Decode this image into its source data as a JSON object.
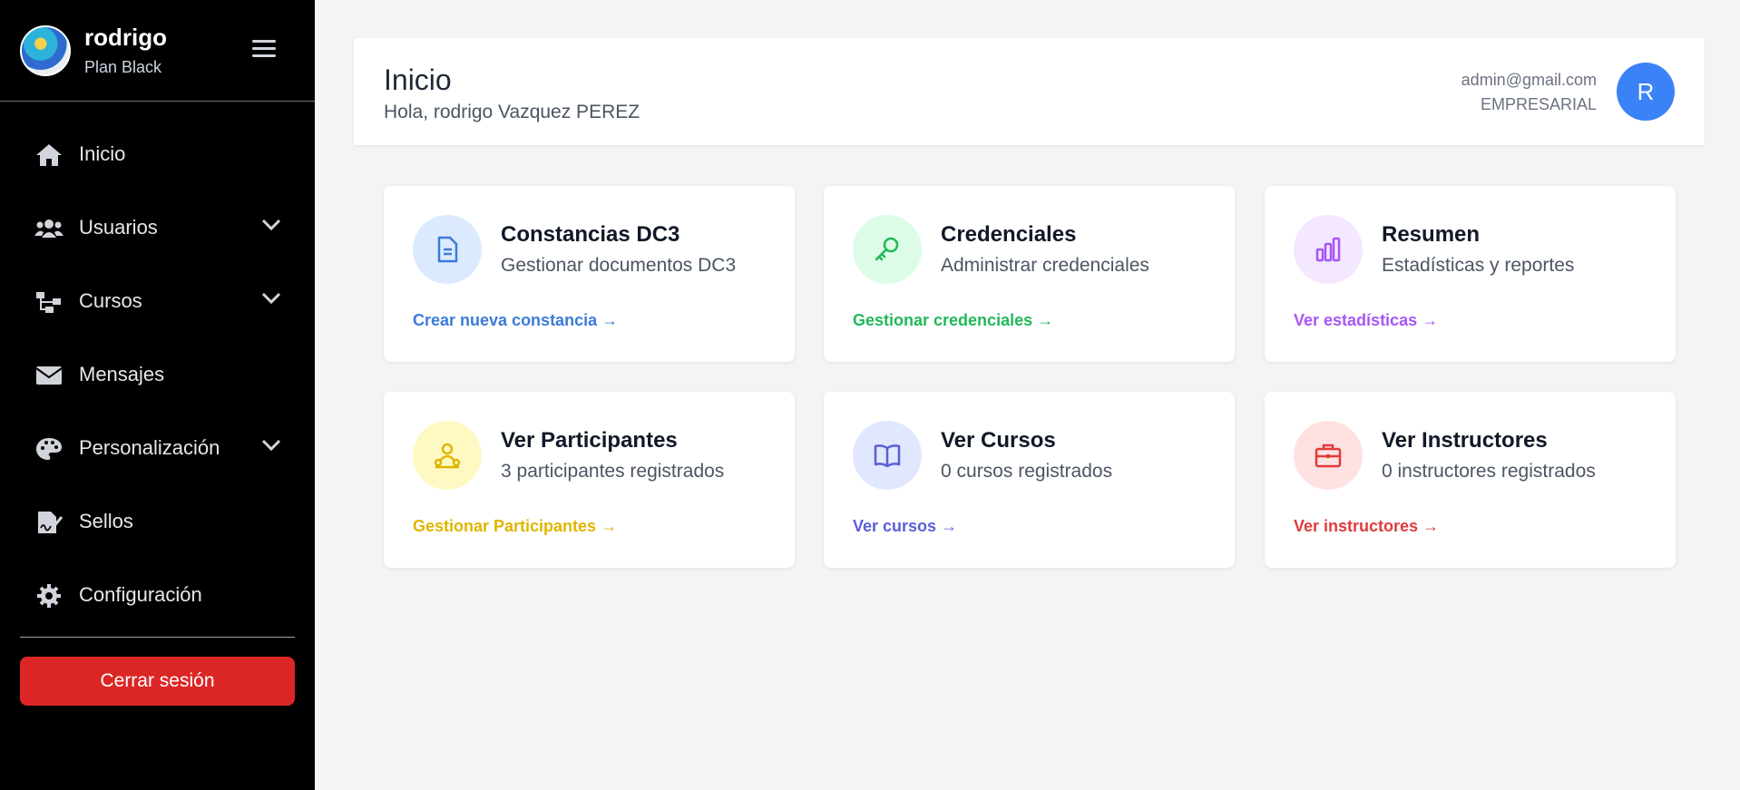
{
  "sidebar": {
    "user_name": "rodrigo",
    "user_plan": "Plan Black",
    "items": [
      {
        "label": "Inicio",
        "icon": "home-icon",
        "has_submenu": false
      },
      {
        "label": "Usuarios",
        "icon": "users-icon",
        "has_submenu": true
      },
      {
        "label": "Cursos",
        "icon": "sitemap-icon",
        "has_submenu": true
      },
      {
        "label": "Mensajes",
        "icon": "envelope-icon",
        "has_submenu": false
      },
      {
        "label": "Personalización",
        "icon": "palette-icon",
        "has_submenu": true
      },
      {
        "label": "Sellos",
        "icon": "signature-icon",
        "has_submenu": false
      },
      {
        "label": "Configuración",
        "icon": "gear-icon",
        "has_submenu": false
      }
    ],
    "logout_label": "Cerrar sesión"
  },
  "header": {
    "title": "Inicio",
    "greeting": "Hola, rodrigo Vazquez PEREZ",
    "email": "admin@gmail.com",
    "plan": "EMPRESARIAL",
    "avatar_letter": "R"
  },
  "cards": [
    {
      "title": "Constancias DC3",
      "subtitle": "Gestionar documentos DC3",
      "link": "Crear nueva constancia →",
      "icon": "document-icon",
      "color": "#3b7bd8",
      "bg": "#dbeafe"
    },
    {
      "title": "Credenciales",
      "subtitle": "Administrar credenciales",
      "link": "Gestionar credenciales →",
      "icon": "key-icon",
      "color": "#22b85a",
      "bg": "#dcfce7"
    },
    {
      "title": "Resumen",
      "subtitle": "Estadísticas y reportes",
      "link": "Ver estadísticas →",
      "icon": "bar-chart-icon",
      "color": "#a855f7",
      "bg": "#f3e8ff"
    },
    {
      "title": "Ver Participantes",
      "subtitle": "3 participantes registrados",
      "link": "Gestionar Participantes →",
      "icon": "participants-icon",
      "color": "#e0b400",
      "bg": "#fef9c3"
    },
    {
      "title": "Ver Cursos",
      "subtitle": "0 cursos registrados",
      "link": "Ver cursos →",
      "icon": "book-icon",
      "color": "#5b5fd6",
      "bg": "#e0e7ff"
    },
    {
      "title": "Ver Instructores",
      "subtitle": "0 instructores registrados",
      "link": "Ver instructores →",
      "icon": "briefcase-icon",
      "color": "#e03b3b",
      "bg": "#fee2e2"
    }
  ]
}
